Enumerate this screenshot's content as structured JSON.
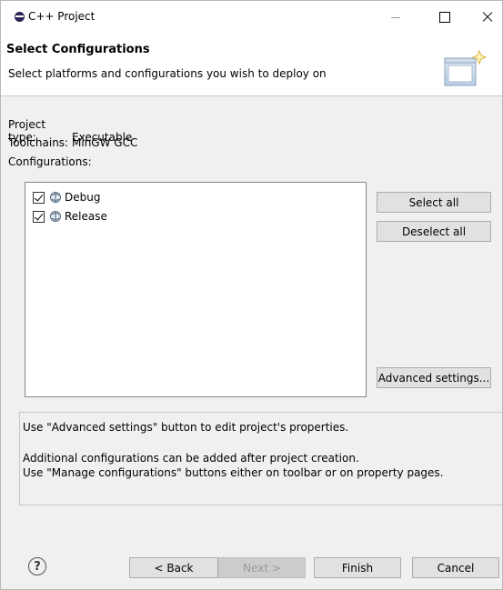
{
  "window": {
    "title": "C++ Project"
  },
  "header": {
    "title": "Select Configurations",
    "description": "Select platforms and configurations you wish to deploy on"
  },
  "info": {
    "project_type_label": "Project type:",
    "project_type_value": "Executable",
    "toolchains_label": "Toolchains:",
    "toolchains_value": "MinGW GCC",
    "configurations_label": "Configurations:"
  },
  "configurations": [
    {
      "label": "Debug",
      "checked": true,
      "icon": "build-config-icon"
    },
    {
      "label": "Release",
      "checked": true,
      "icon": "build-config-icon"
    }
  ],
  "side_buttons": {
    "select_all": "Select all",
    "deselect_all": "Deselect all",
    "advanced": "Advanced settings..."
  },
  "messages": {
    "line1": "Use \"Advanced settings\" button to edit project's properties.",
    "line2": "Additional configurations can be added after project creation.",
    "line3": "Use \"Manage configurations\" buttons either on toolbar or on property pages."
  },
  "footer": {
    "help": "?",
    "back": "< Back",
    "next": "Next >",
    "finish": "Finish",
    "cancel": "Cancel"
  }
}
